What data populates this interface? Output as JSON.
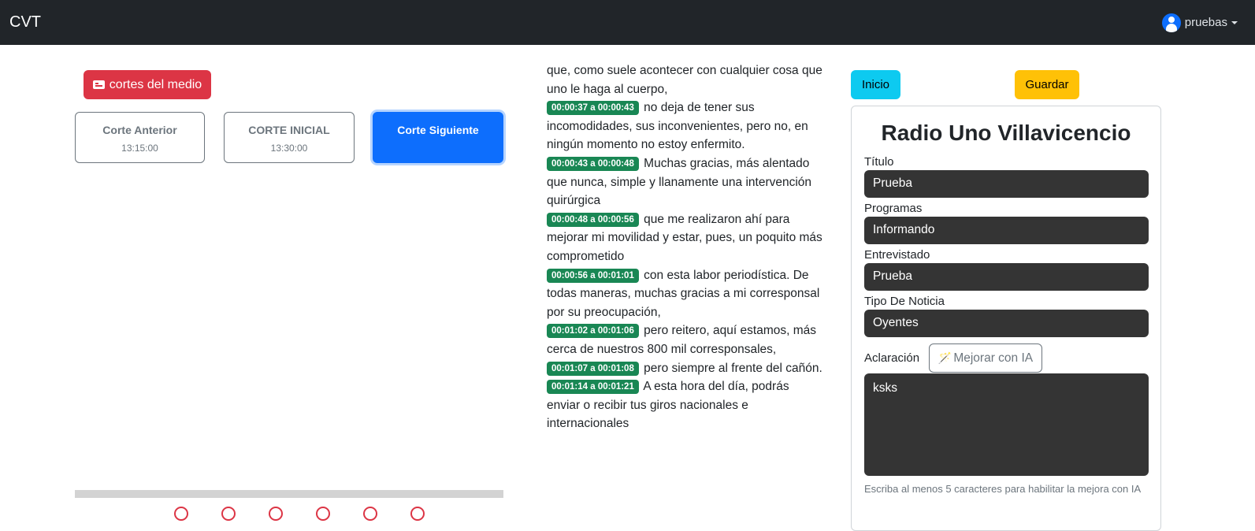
{
  "navbar": {
    "brand": "CVT",
    "user": "pruebas"
  },
  "left": {
    "cortes_button": "cortes del medio",
    "cortes": [
      {
        "title": "Corte Anterior",
        "time": "13:15:00",
        "active": false
      },
      {
        "title": "CORTE INICIAL",
        "time": "13:30:00",
        "active": false
      },
      {
        "title": "Corte Siguiente",
        "time": "",
        "active": true
      }
    ]
  },
  "transcript": {
    "intro": "que, como suele acontecer con cualquier cosa que uno le haga al cuerpo,",
    "segments": [
      {
        "ts": "00:00:37 a 00:00:43",
        "text": "no deja de tener sus incomodidades, sus inconvenientes, pero no, en ningún momento no estoy enfermito."
      },
      {
        "ts": "00:00:43 a 00:00:48",
        "text": "Muchas gracias, más alentado que nunca, simple y llanamente una intervención quirúrgica"
      },
      {
        "ts": "00:00:48 a 00:00:56",
        "text": "que me realizaron ahí para mejorar mi movilidad y estar, pues, un poquito más comprometido"
      },
      {
        "ts": "00:00:56 a 00:01:01",
        "text": "con esta labor periodística. De todas maneras, muchas gracias a mi corresponsal por su preocupación,"
      },
      {
        "ts": "00:01:02 a 00:01:06",
        "text": "pero reitero, aquí estamos, más cerca de nuestros 800 mil corresponsales,"
      },
      {
        "ts": "00:01:07 a 00:01:08",
        "text": "pero siempre al frente del cañón."
      },
      {
        "ts": "00:01:14 a 00:01:21",
        "text": "A esta hora del día, podrás enviar o recibir tus giros nacionales e internacionales"
      }
    ]
  },
  "right": {
    "inicio": "Inicio",
    "guardar": "Guardar",
    "station": "Radio Uno Villavicencio",
    "titulo_label": "Título",
    "titulo_value": "Prueba",
    "programas_label": "Programas",
    "programas_value": "Informando",
    "entrevistado_label": "Entrevistado",
    "entrevistado_value": "Prueba",
    "tipo_label": "Tipo De Noticia",
    "tipo_value": "Oyentes",
    "aclaracion_label": "Aclaración",
    "mejorar_button": "Mejorar con IA",
    "aclaracion_value": "ksks",
    "help_text": "Escriba al menos 5 caracteres para habilitar la mejora con IA"
  },
  "colors": {
    "danger": "#dc3545",
    "primary": "#0d6efd",
    "success": "#198754",
    "info": "#0dcaf0",
    "warning": "#ffc107"
  }
}
